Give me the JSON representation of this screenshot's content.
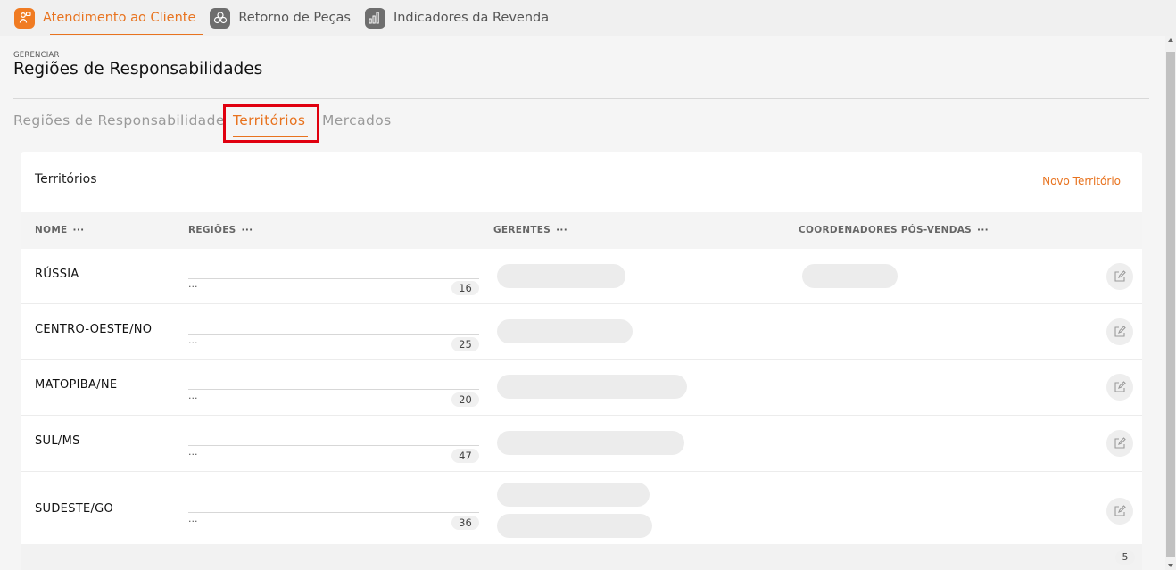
{
  "topnav": {
    "items": [
      {
        "label": "Atendimento ao Cliente",
        "icon": "customer-service-icon",
        "active": true
      },
      {
        "label": "Retorno de Peças",
        "icon": "parts-return-icon",
        "active": false
      },
      {
        "label": "Indicadores da Revenda",
        "icon": "bar-chart-icon",
        "active": false
      }
    ]
  },
  "header": {
    "eyebrow": "GERENCIAR",
    "title": "Regiões de Responsabilidades"
  },
  "tabs": [
    {
      "label": "Regiões de Responsabilidade",
      "active": false
    },
    {
      "label": "Territórios",
      "active": true
    },
    {
      "label": "Mercados",
      "active": false
    }
  ],
  "card": {
    "title": "Territórios",
    "new_button": "Novo Território",
    "columns": [
      "NOME",
      "REGIÕES",
      "GERENTES",
      "COORDENADORES PÓS-VENDAS"
    ],
    "column_menu": "···",
    "rows": [
      {
        "name": "RÚSSIA",
        "regions_more": "···",
        "regions_count": "16"
      },
      {
        "name": "CENTRO-OESTE/NO",
        "regions_more": "···",
        "regions_count": "25"
      },
      {
        "name": "MATOPIBA/NE",
        "regions_more": "···",
        "regions_count": "20"
      },
      {
        "name": "SUL/MS",
        "regions_more": "···",
        "regions_count": "47"
      },
      {
        "name": "SUDESTE/GO",
        "regions_more": "···",
        "regions_count": "36"
      }
    ],
    "total": "5"
  },
  "colors": {
    "accent": "#e8731f",
    "highlight": "#e0000f"
  }
}
